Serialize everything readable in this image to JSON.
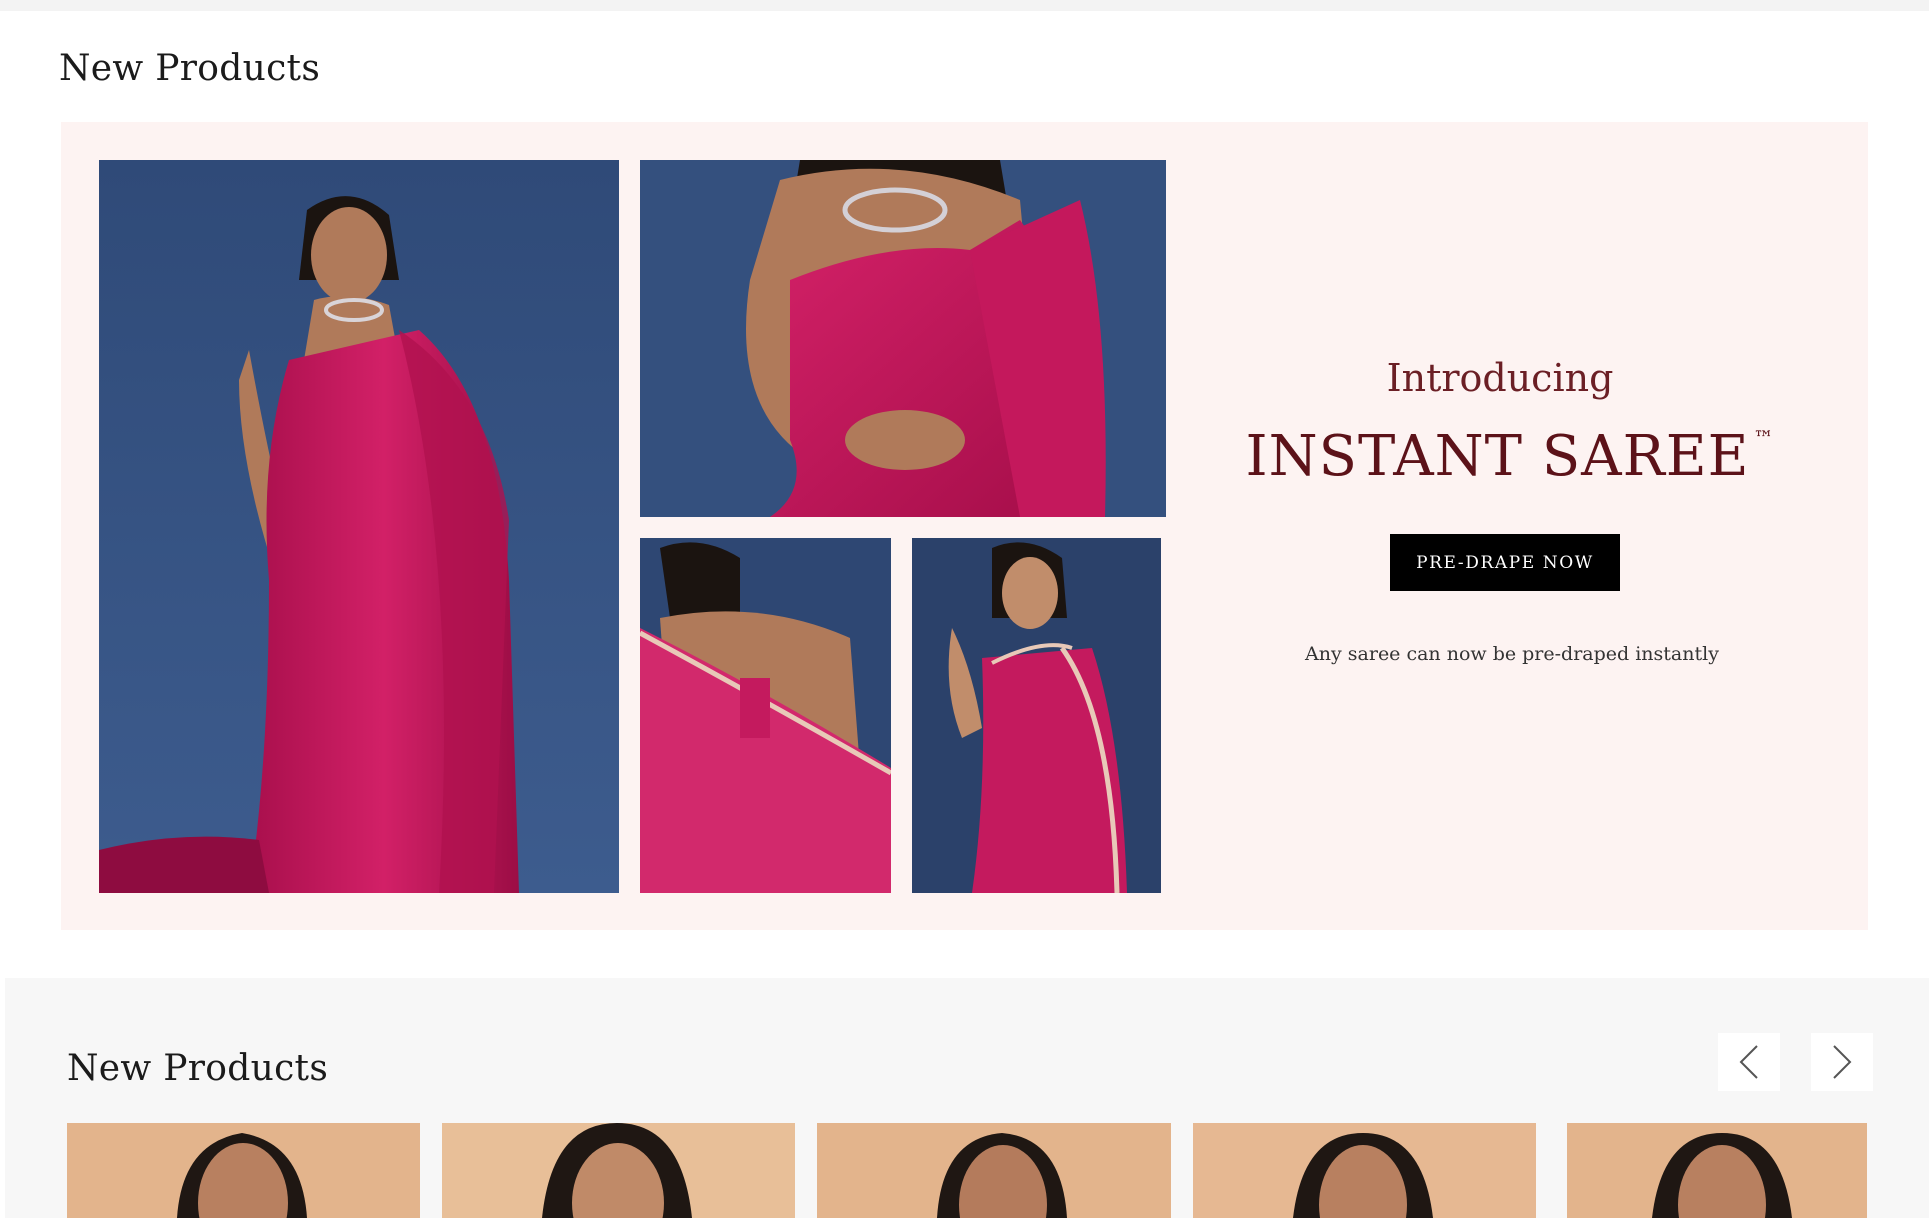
{
  "sections": {
    "new_products_title_1": "New Products",
    "new_products_title_2": "New Products"
  },
  "promo": {
    "intro": "Introducing",
    "headline": "INSTANT SAREE",
    "trademark": "™",
    "cta_label": "PRE-DRAPE NOW",
    "caption": "Any saree can now be pre-draped instantly"
  },
  "carousel": {
    "prev_icon": "chevron-left-icon",
    "next_icon": "chevron-right-icon",
    "card_count": 5
  },
  "colors": {
    "banner_bg": "#fdf3f2",
    "headline": "#5c1219",
    "saree_pink": "#c8185f",
    "studio_blue": "#34507e",
    "card_peach": "#e3b48c",
    "section_grey": "#f7f7f7"
  }
}
